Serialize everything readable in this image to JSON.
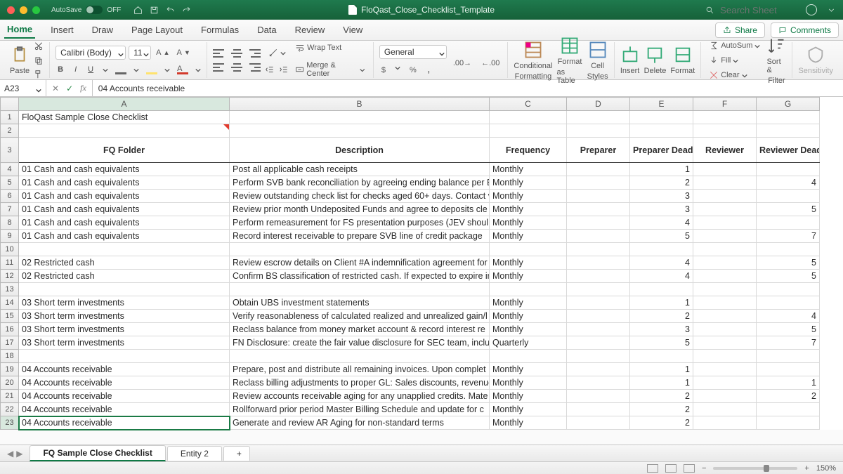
{
  "titlebar": {
    "autosave_label": "AutoSave",
    "autosave_state": "OFF",
    "doc_title": "FloQast_Close_Checklist_Template",
    "search_placeholder": "Search Sheet"
  },
  "menu": {
    "tabs": [
      "Home",
      "Insert",
      "Draw",
      "Page Layout",
      "Formulas",
      "Data",
      "Review",
      "View"
    ],
    "share": "Share",
    "comments": "Comments"
  },
  "ribbon": {
    "paste": "Paste",
    "font_name": "Calibri (Body)",
    "font_size": "11",
    "wrap_text": "Wrap Text",
    "merge_center": "Merge & Center",
    "number_format": "General",
    "cond_fmt_line1": "Conditional",
    "cond_fmt_line2": "Formatting",
    "fmt_table_line1": "Format",
    "fmt_table_line2": "as Table",
    "cell_styles_line1": "Cell",
    "cell_styles_line2": "Styles",
    "insert": "Insert",
    "delete": "Delete",
    "format": "Format",
    "autosum": "AutoSum",
    "fill": "Fill",
    "clear": "Clear",
    "sort_filter_line1": "Sort &",
    "sort_filter_line2": "Filter",
    "sensitivity": "Sensitivity"
  },
  "formula": {
    "cell_ref": "A23",
    "content": "04 Accounts receivable"
  },
  "grid": {
    "columns": [
      "A",
      "B",
      "C",
      "D",
      "E",
      "F",
      "G"
    ],
    "title": "FloQast Sample Close Checklist",
    "headers": {
      "A": "FQ Folder",
      "B": "Description",
      "C": "Frequency",
      "D": "Preparer",
      "E": "Preparer Deadline",
      "F": "Reviewer",
      "G": "Reviewer Deadline"
    },
    "rows": [
      {
        "n": 4,
        "A": "01 Cash and cash equivalents",
        "B": "Post all applicable cash receipts",
        "C": "Monthly",
        "E": "1",
        "G": ""
      },
      {
        "n": 5,
        "A": "01 Cash and cash equivalents",
        "B": "Perform SVB bank reconciliation by agreeing ending balance per E",
        "C": "Monthly",
        "E": "2",
        "G": "4"
      },
      {
        "n": 6,
        "A": "01 Cash and cash equivalents",
        "B": "Review outstanding check list for checks aged 60+ days. Contact v",
        "C": "Monthly",
        "E": "3",
        "G": ""
      },
      {
        "n": 7,
        "A": "01 Cash and cash equivalents",
        "B": "Review prior month Undeposited Funds and agree to deposits cle",
        "C": "Monthly",
        "E": "3",
        "G": "5"
      },
      {
        "n": 8,
        "A": "01 Cash and cash equivalents",
        "B": "Perform remeasurement for FS presentation purposes (JEV shoul",
        "C": "Monthly",
        "E": "4",
        "G": ""
      },
      {
        "n": 9,
        "A": "01 Cash and cash equivalents",
        "B": "Record interest receivable to prepare SVB line of credit package",
        "C": "Monthly",
        "E": "5",
        "G": "7"
      },
      {
        "n": 10,
        "A": "",
        "B": "",
        "C": "",
        "E": "",
        "G": ""
      },
      {
        "n": 11,
        "A": "02 Restricted cash",
        "B": "Review escrow details on Client #A indemnification agreement for",
        "C": "Monthly",
        "E": "4",
        "G": "5"
      },
      {
        "n": 12,
        "A": "02 Restricted cash",
        "B": "Confirm BS classification of restricted cash. If expected to expire ir",
        "C": "Monthly",
        "E": "4",
        "G": "5"
      },
      {
        "n": 13,
        "A": "",
        "B": "",
        "C": "",
        "E": "",
        "G": ""
      },
      {
        "n": 14,
        "A": "03 Short term investments",
        "B": "Obtain UBS investment statements",
        "C": "Monthly",
        "E": "1",
        "G": ""
      },
      {
        "n": 15,
        "A": "03 Short term investments",
        "B": "Verify reasonableness of calculated realized and unrealized gain/l",
        "C": "Monthly",
        "E": "2",
        "G": "4"
      },
      {
        "n": 16,
        "A": "03 Short term investments",
        "B": "Reclass balance from money market account & record interest re",
        "C": "Monthly",
        "E": "3",
        "G": "5"
      },
      {
        "n": 17,
        "A": "03 Short term investments",
        "B": "FN Disclosure: create the fair value disclosure for SEC team, includ",
        "C": "Quarterly",
        "E": "5",
        "G": "7"
      },
      {
        "n": 18,
        "A": "",
        "B": "",
        "C": "",
        "E": "",
        "G": ""
      },
      {
        "n": 19,
        "A": "04 Accounts receivable",
        "B": "Prepare, post and distribute all remaining invoices. Upon complet",
        "C": "Monthly",
        "E": "1",
        "G": ""
      },
      {
        "n": 20,
        "A": "04 Accounts receivable",
        "B": "Reclass billing adjustments to proper GL: Sales discounts, revenue",
        "C": "Monthly",
        "E": "1",
        "G": "1"
      },
      {
        "n": 21,
        "A": "04 Accounts receivable",
        "B": "Review accounts receivable aging for any unapplied credits. Mate",
        "C": "Monthly",
        "E": "2",
        "G": "2"
      },
      {
        "n": 22,
        "A": "04 Accounts receivable",
        "B": "Rollforward prior period Master Billing Schedule and update for c",
        "C": "Monthly",
        "E": "2",
        "G": ""
      },
      {
        "n": 23,
        "A": "04 Accounts receivable",
        "B": "Generate and review AR Aging for non-standard terms",
        "C": "Monthly",
        "E": "2",
        "G": "",
        "sel": true
      }
    ]
  },
  "sheets": {
    "active": "FQ Sample Close Checklist",
    "other": "Entity 2"
  },
  "status": {
    "zoom": "150%"
  }
}
